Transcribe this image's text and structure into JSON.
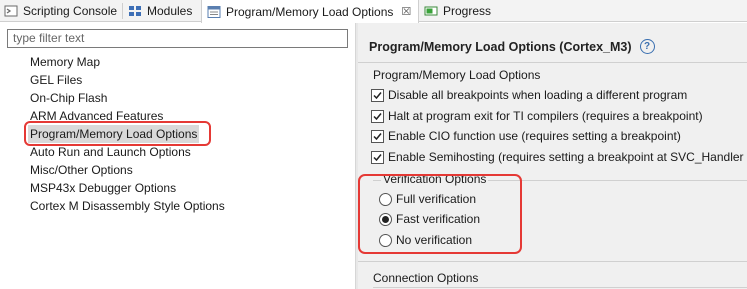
{
  "tabs": [
    {
      "label": "Scripting Console",
      "icon": "console-icon"
    },
    {
      "label": "Modules",
      "icon": "modules-icon"
    },
    {
      "label": "Program/Memory Load Options",
      "icon": "options-page-icon",
      "active": true,
      "close": "☒"
    },
    {
      "label": "Progress",
      "icon": "progress-icon"
    }
  ],
  "filter": {
    "placeholder": "type filter text"
  },
  "tree": {
    "items": [
      {
        "label": "Memory Map"
      },
      {
        "label": "GEL Files"
      },
      {
        "label": "On-Chip Flash"
      },
      {
        "label": "ARM Advanced Features"
      },
      {
        "label": "Program/Memory Load Options",
        "selected": true
      },
      {
        "label": "Auto Run and Launch Options"
      },
      {
        "label": "Misc/Other Options"
      },
      {
        "label": "MSP43x Debugger Options"
      },
      {
        "label": "Cortex M Disassembly Style Options"
      }
    ]
  },
  "page": {
    "title": "Program/Memory Load Options (Cortex_M3)",
    "help": "?"
  },
  "load_options": {
    "group_title": "Program/Memory Load Options",
    "checkboxes": [
      {
        "label": "Disable all breakpoints when loading a different program",
        "checked": true
      },
      {
        "label": "Halt at program exit for TI compilers (requires a breakpoint)",
        "checked": true
      },
      {
        "label": "Enable CIO function use (requires setting a breakpoint)",
        "checked": true
      },
      {
        "label": "Enable Semihosting (requires setting a breakpoint at SVC_Handler )",
        "checked": true
      }
    ]
  },
  "verification": {
    "group_title": "Verification Options",
    "options": [
      {
        "label": "Full verification",
        "selected": false
      },
      {
        "label": "Fast verification",
        "selected": true
      },
      {
        "label": "No verification",
        "selected": false
      }
    ]
  },
  "connection": {
    "group_title": "Connection Options"
  },
  "colors": {
    "highlight": "#e53935",
    "selection": "#d9d9d9",
    "panel_bg": "#f0f0f0"
  }
}
